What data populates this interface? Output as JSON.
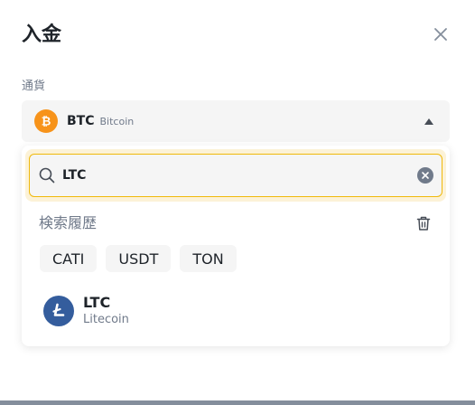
{
  "dialog": {
    "title": "入金"
  },
  "currency_field": {
    "label": "通貨",
    "selected": {
      "symbol": "BTC",
      "name": "Bitcoin"
    }
  },
  "search": {
    "value": "LTC",
    "placeholder": ""
  },
  "history": {
    "label": "検索履歴",
    "items": [
      "CATI",
      "USDT",
      "TON"
    ]
  },
  "results": [
    {
      "symbol": "LTC",
      "name": "Litecoin"
    }
  ],
  "colors": {
    "accent": "#f0b90b",
    "btc": "#f7931a",
    "ltc": "#345d9d",
    "text": "#1e2329",
    "muted": "#707a8a"
  }
}
